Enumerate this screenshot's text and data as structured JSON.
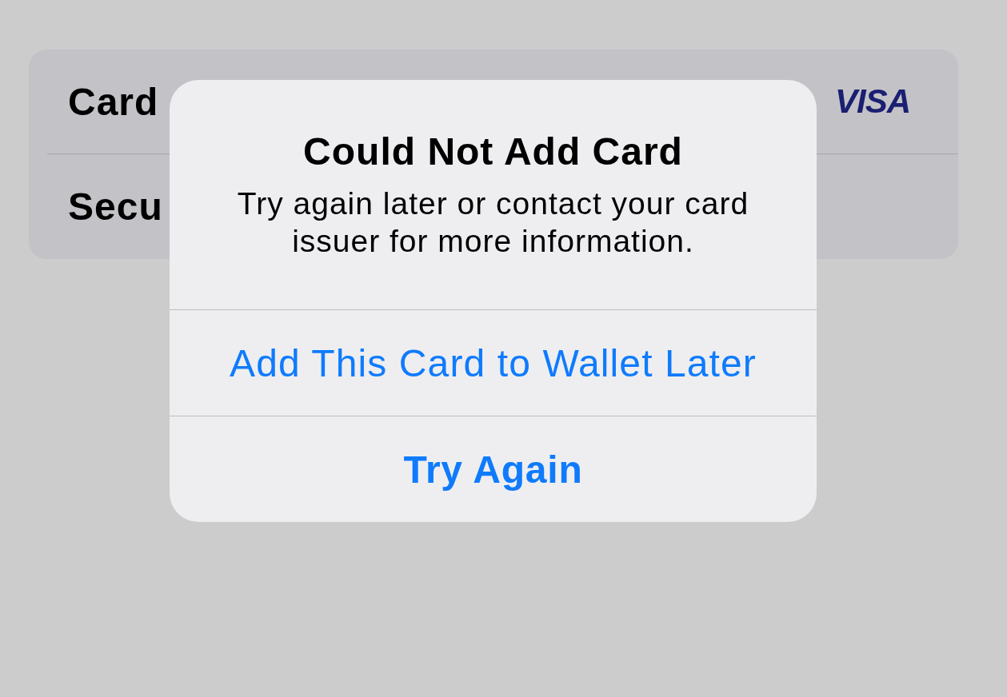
{
  "settings_card": {
    "rows": [
      {
        "label": "Card",
        "logo": "VISA"
      },
      {
        "label": "Secu"
      }
    ]
  },
  "alert": {
    "title": "Could Not Add Card",
    "message": "Try again later or contact your card issuer for more information.",
    "actions": [
      {
        "label": "Add This Card to Wallet Later",
        "kind": "default"
      },
      {
        "label": "Try Again",
        "kind": "preferred"
      }
    ]
  }
}
